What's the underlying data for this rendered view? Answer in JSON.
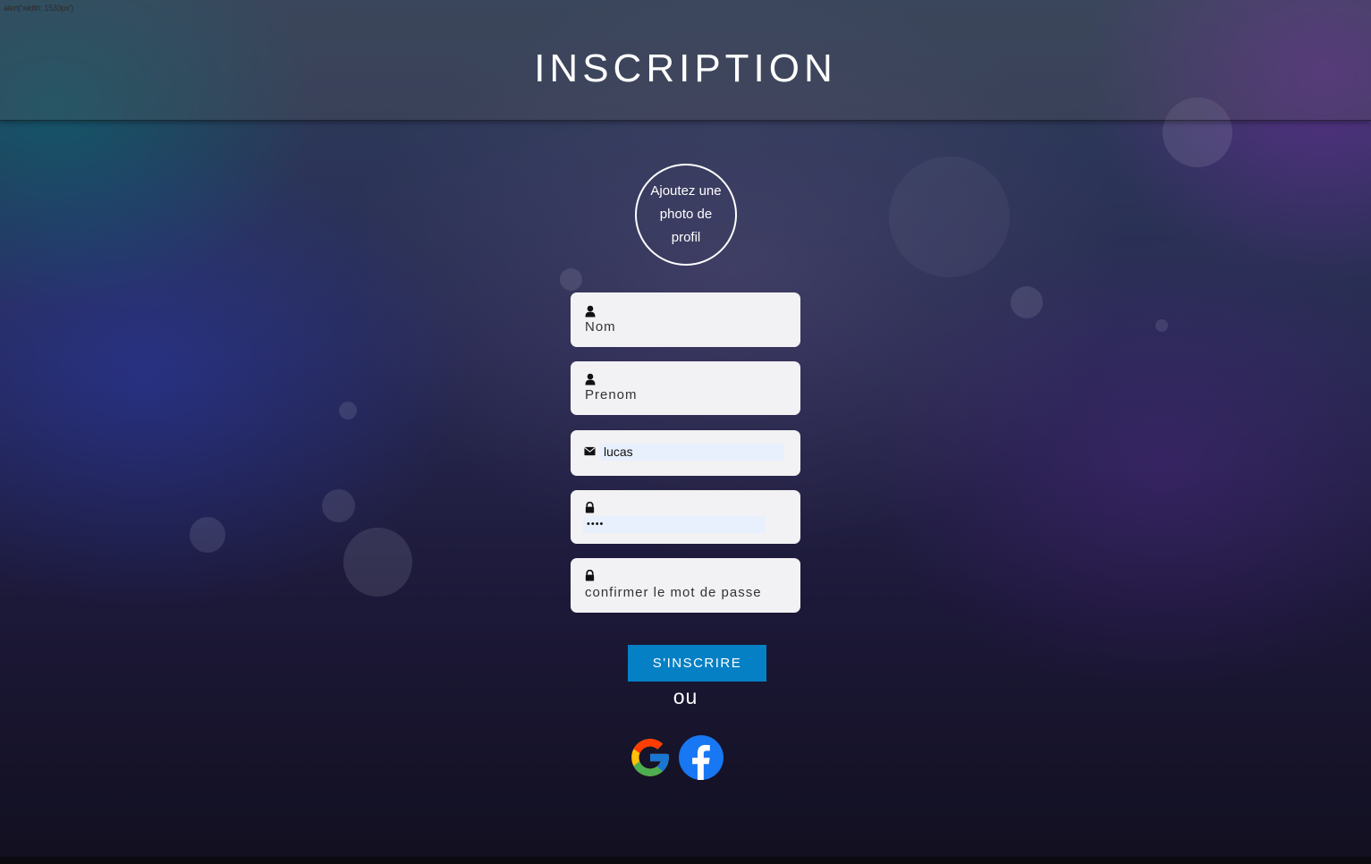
{
  "corner_text": "alert('width: 1533px')",
  "header": {
    "title": "INSCRIPTION"
  },
  "avatar": {
    "label": "Ajoutez une photo de profil",
    "icon": "camera-upload-placeholder"
  },
  "form": {
    "nom": {
      "placeholder": "Nom",
      "icon": "user-icon"
    },
    "prenom": {
      "placeholder": "Prenom",
      "icon": "user-icon"
    },
    "email": {
      "value": "lucas",
      "icon": "envelope-icon"
    },
    "password": {
      "value": "••••",
      "icon": "lock-icon"
    },
    "confirm_password": {
      "placeholder": "confirmer le mot de passe",
      "icon": "lock-icon"
    }
  },
  "submit_label": "S'INSCRIRE",
  "or_text": "ou",
  "social": {
    "google": "google-icon",
    "facebook": "facebook-icon"
  },
  "colors": {
    "button": "#0580c5",
    "field_bg": "#f2f1f3",
    "autofill_bg": "#e8f0fe",
    "facebook": "#1877f2"
  }
}
